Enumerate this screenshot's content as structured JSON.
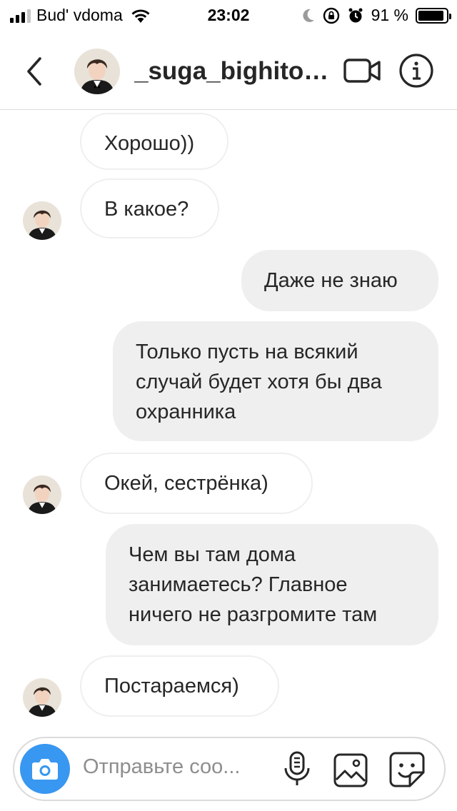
{
  "status_bar": {
    "carrier": "Bud' vdoma",
    "time": "23:02",
    "battery_percent": "91 %",
    "battery_level": 0.91,
    "icons": [
      "signal-icon",
      "wifi-icon",
      "moon-icon",
      "rotation-lock-icon",
      "alarm-icon",
      "battery-icon"
    ]
  },
  "header": {
    "title": "_suga_bighitoff...",
    "icons": [
      "back-icon",
      "avatar",
      "video-call-icon",
      "info-icon"
    ]
  },
  "messages": [
    {
      "sender": "them",
      "text": "Хорошо))",
      "avatar": false
    },
    {
      "sender": "them",
      "text": "В какое?",
      "avatar": true
    },
    {
      "sender": "me",
      "text": "Даже не знаю"
    },
    {
      "sender": "me",
      "lines": [
        "Только пусть на всякий",
        "случай будет хотя бы два",
        "охранника"
      ]
    },
    {
      "sender": "them",
      "text": "Окей, сестрёнка)",
      "avatar": true
    },
    {
      "sender": "me",
      "lines": [
        "Чем вы там дома",
        "занимаетесь? Главное",
        "ничего не разгромите там"
      ]
    },
    {
      "sender": "them",
      "text": "Постараемся)",
      "avatar": true
    }
  ],
  "composer": {
    "placeholder": "Отправьте соо...",
    "icons": [
      "camera-icon",
      "microphone-icon",
      "gallery-icon",
      "sticker-icon"
    ]
  },
  "colors": {
    "accent": "#3897f0",
    "bubble_out": "#efefef",
    "bubble_in_border": "#efefef",
    "text": "#262626",
    "placeholder": "#8e8e8e",
    "divider": "#dbdbdb"
  }
}
